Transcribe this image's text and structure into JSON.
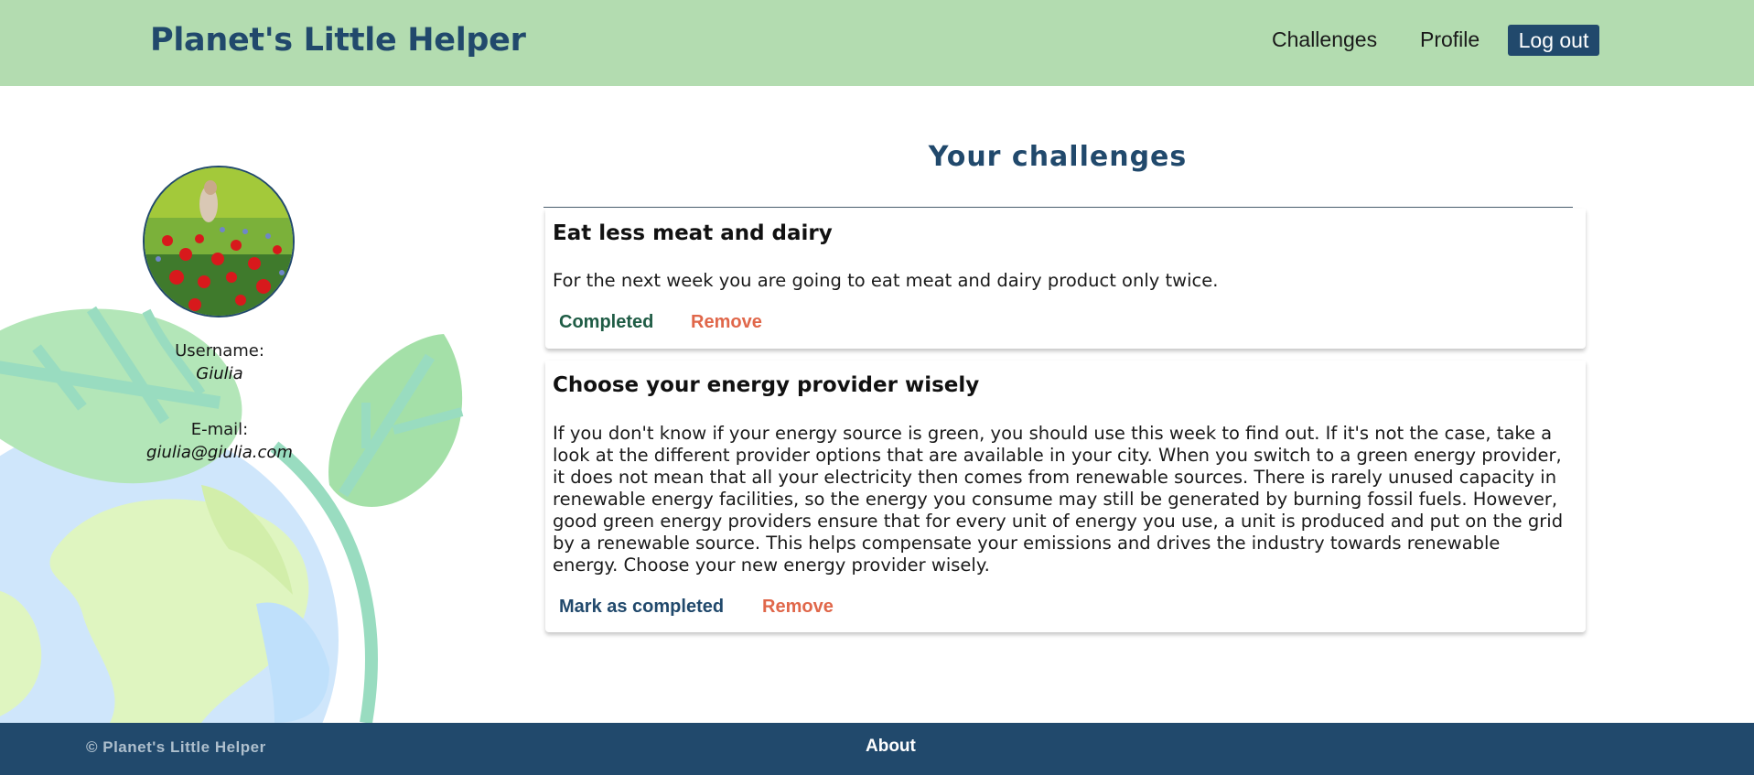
{
  "header": {
    "brand": "Planet's Little Helper",
    "nav": {
      "challenges": "Challenges",
      "profile": "Profile",
      "logout": "Log out"
    }
  },
  "profile": {
    "username_label": "Username:",
    "username": "Giulia",
    "email_label": "E-mail:",
    "email": "giulia@giulia.com"
  },
  "main": {
    "title": "Your challenges",
    "challenges": [
      {
        "title": "Eat less meat and dairy",
        "description": "For the next week you are going to eat meat and dairy product only twice.",
        "status_action": "Completed",
        "remove": "Remove"
      },
      {
        "title": "Choose your energy provider wisely",
        "description": "If you don't know if your energy source is green, you should use this week to find out. If it's not the case, take a look at the different provider options that are available in your city. When you switch to a green energy provider, it does not mean that all your electricity then comes from renewable sources. There is rarely unused capacity in renewable energy facilities, so the energy you consume may still be generated by burning fossil fuels. However, good green energy providers ensure that for every unit of energy you use, a unit is produced and put on the grid by a renewable source. This helps compensate your emissions and drives the industry towards renewable energy. Choose your new energy provider wisely.",
        "status_action": "Mark as completed",
        "remove": "Remove"
      }
    ]
  },
  "footer": {
    "copyright": "© Planet's Little Helper",
    "about": "About"
  },
  "colors": {
    "header_bg": "#b3dcb0",
    "brand": "#21496c",
    "footer_bg": "#21496c",
    "completed": "#1f5c45",
    "remove": "#e0674a"
  }
}
